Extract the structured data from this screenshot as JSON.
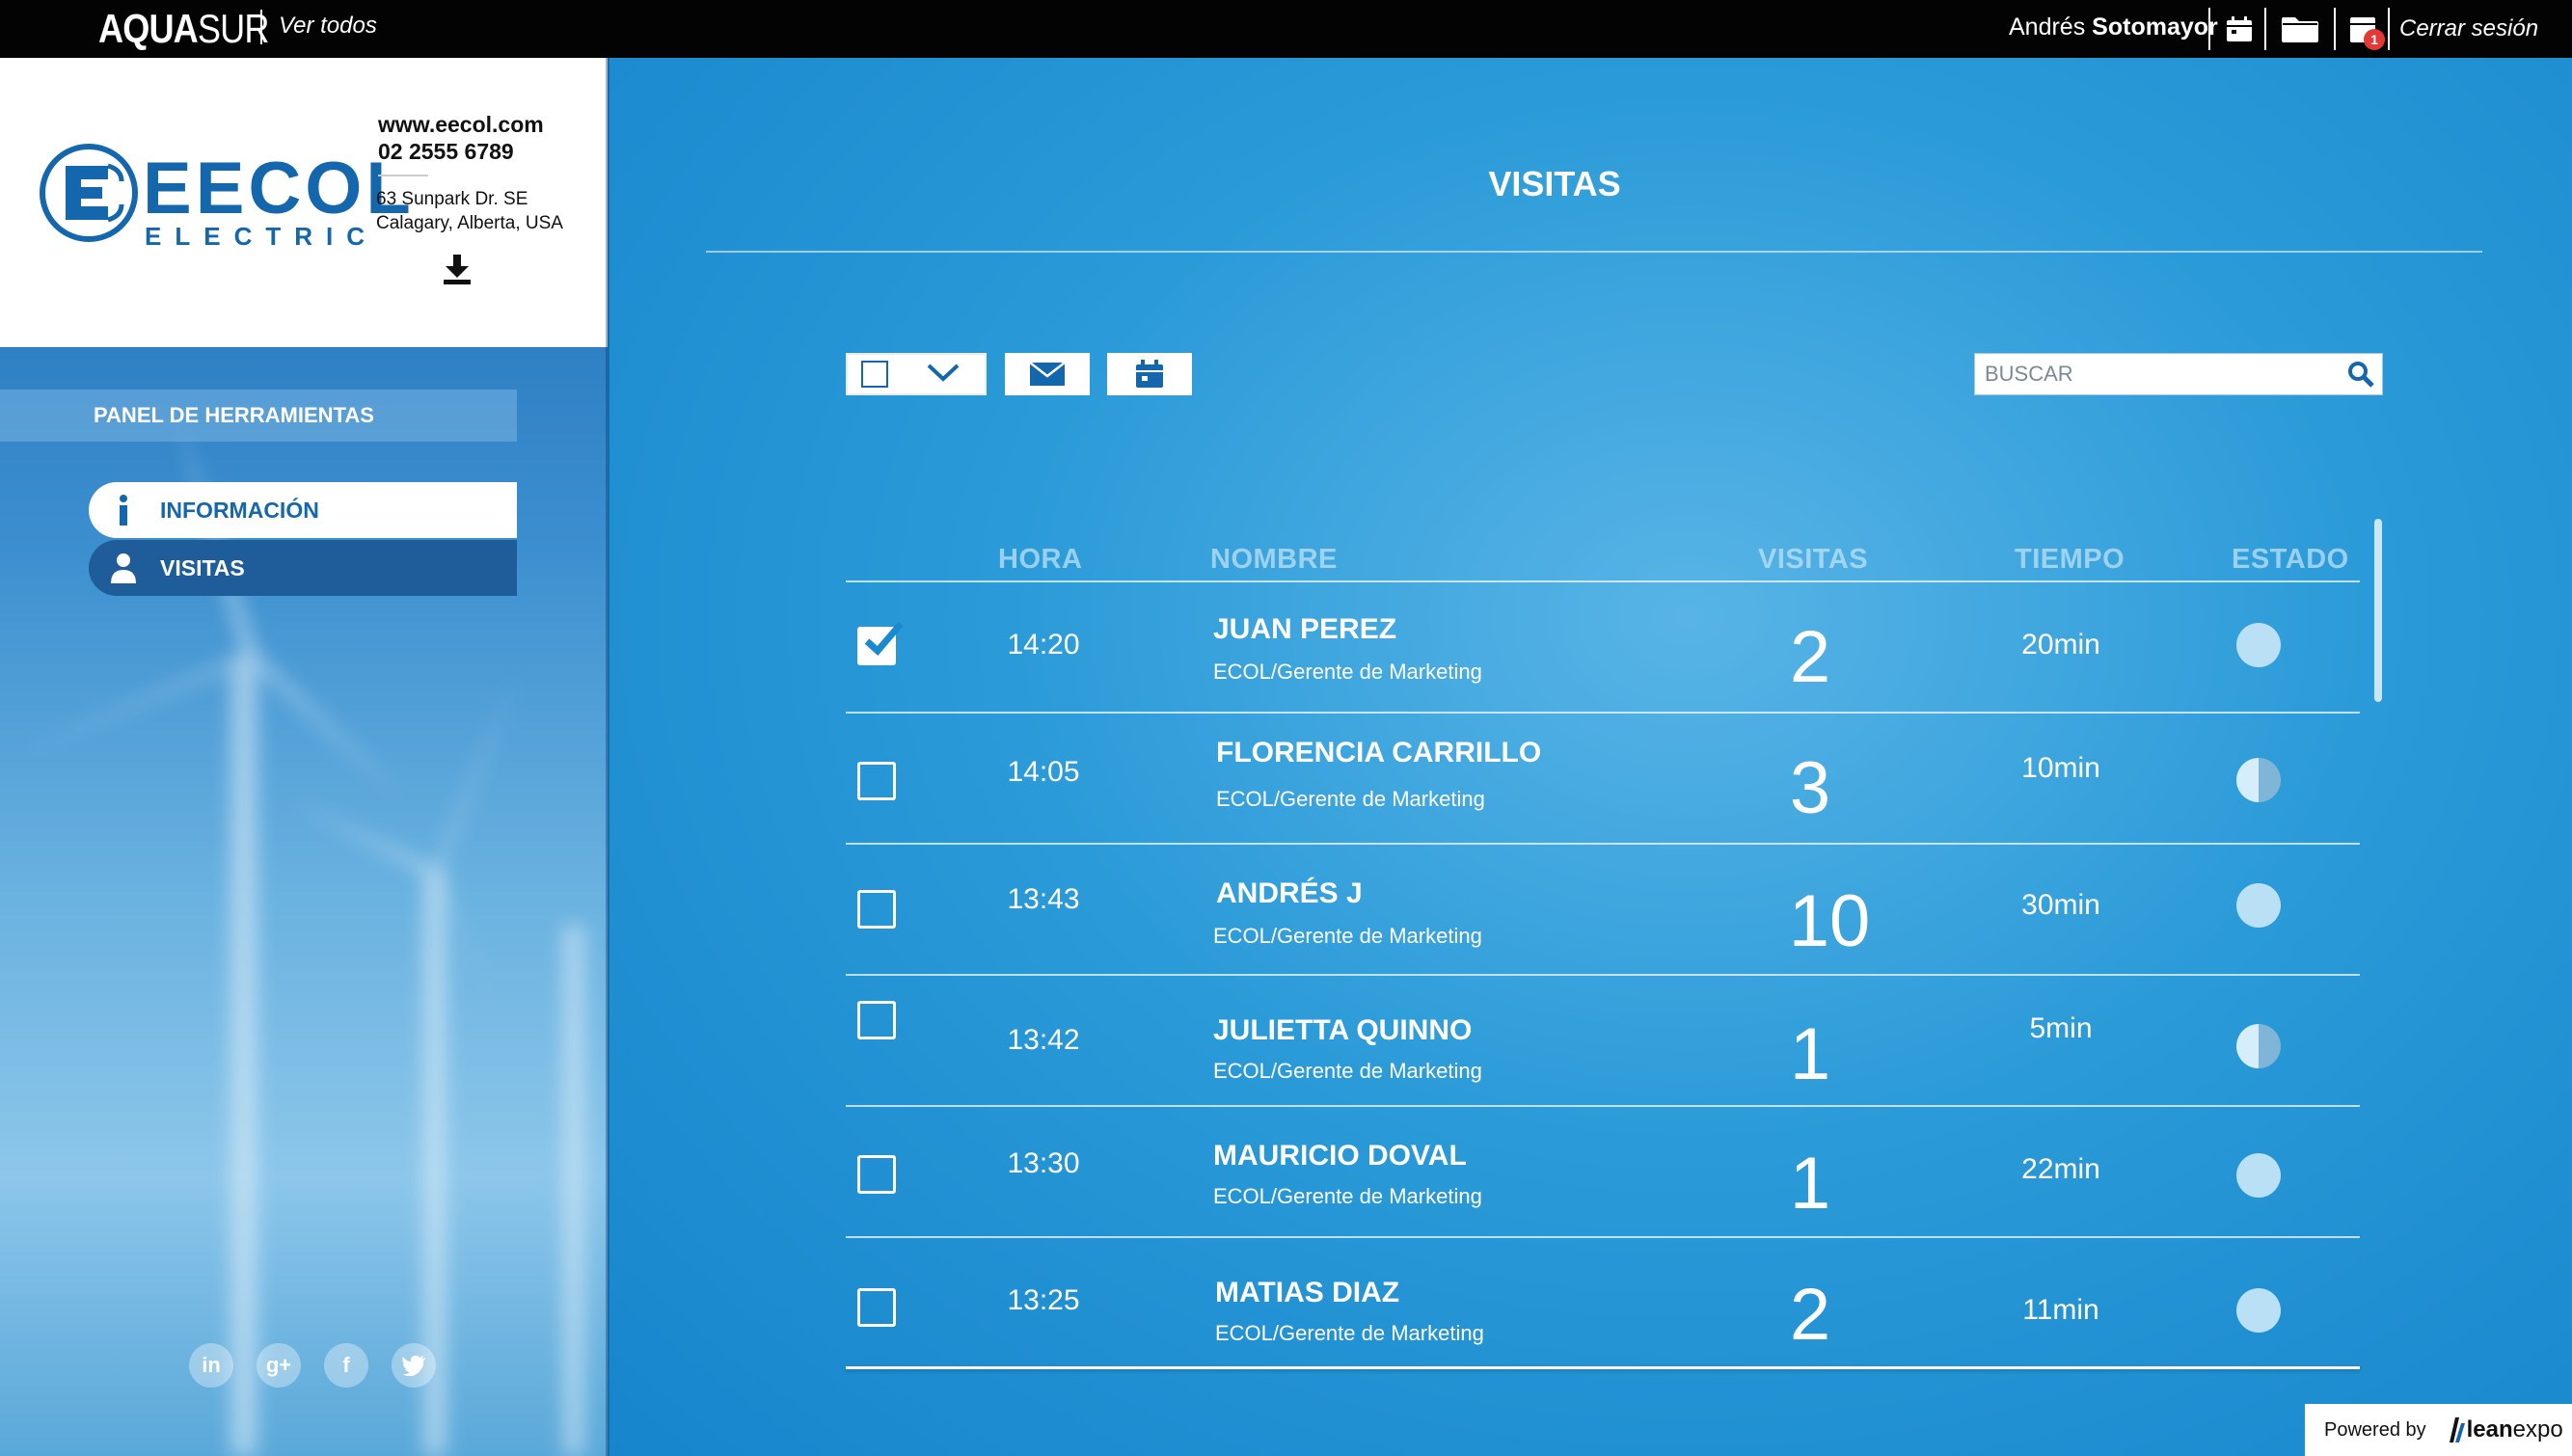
{
  "topbar": {
    "brand_bold": "AQUA",
    "brand_light": "SUR",
    "ver_todos": "Ver todos",
    "user_first": "Andrés ",
    "user_last": "Sotomayor",
    "badge_count": "1",
    "logout": "Cerrar sesión"
  },
  "company": {
    "logo_word": "EECOL",
    "logo_sub": "ELECTRIC",
    "website": "www.eecol.com",
    "phone": "02 2555 6789",
    "address_line1": "63 Sunpark Dr. SE",
    "address_line2": "Calagary, Alberta, USA"
  },
  "sidebar": {
    "panel_title": "PANEL DE HERRAMIENTAS",
    "items": [
      {
        "label": "INFORMACIÓN",
        "icon": "info-icon",
        "active": true
      },
      {
        "label": "VISITAS",
        "icon": "user-icon",
        "active": false
      }
    ],
    "socials": [
      "linkedin-icon",
      "google-plus-icon",
      "facebook-icon",
      "twitter-icon"
    ]
  },
  "main": {
    "title": "VISITAS",
    "search_placeholder": "BUSCAR",
    "columns": {
      "hora": "HORA",
      "nombre": "NOMBRE",
      "visitas": "VISITAS",
      "tiempo": "TIEMPO",
      "estado": "ESTADO"
    },
    "rows": [
      {
        "checked": true,
        "hora": "14:20",
        "nombre": "JUAN PEREZ",
        "sub": "ECOL/Gerente de Marketing",
        "visitas": "2",
        "tiempo": "20min",
        "estado": "full"
      },
      {
        "checked": false,
        "hora": "14:05",
        "nombre": "FLORENCIA CARRILLO",
        "sub": "ECOL/Gerente de Marketing",
        "visitas": "3",
        "tiempo": "10min",
        "estado": "half"
      },
      {
        "checked": false,
        "hora": "13:43",
        "nombre": "ANDRÉS J",
        "sub": "ECOL/Gerente de Marketing",
        "visitas": "10",
        "tiempo": "30min",
        "estado": "full"
      },
      {
        "checked": false,
        "hora": "13:42",
        "nombre": "JULIETTA QUINNO",
        "sub": "ECOL/Gerente de Marketing",
        "visitas": "1",
        "tiempo": "5min",
        "estado": "half"
      },
      {
        "checked": false,
        "hora": "13:30",
        "nombre": "MAURICIO DOVAL",
        "sub": "ECOL/Gerente de Marketing",
        "visitas": "1",
        "tiempo": "22min",
        "estado": "full"
      },
      {
        "checked": false,
        "hora": "13:25",
        "nombre": "MATIAS DIAZ",
        "sub": "ECOL/Gerente de Marketing",
        "visitas": "2",
        "tiempo": "11min",
        "estado": "full"
      }
    ]
  },
  "footer": {
    "powered_by": "Powered by",
    "brand_bold": "lean",
    "brand_light": "expo"
  },
  "colors": {
    "accent": "#1467ad",
    "topbar": "#030303",
    "main_bg": "#2a9ad8",
    "badge": "#e53935"
  }
}
